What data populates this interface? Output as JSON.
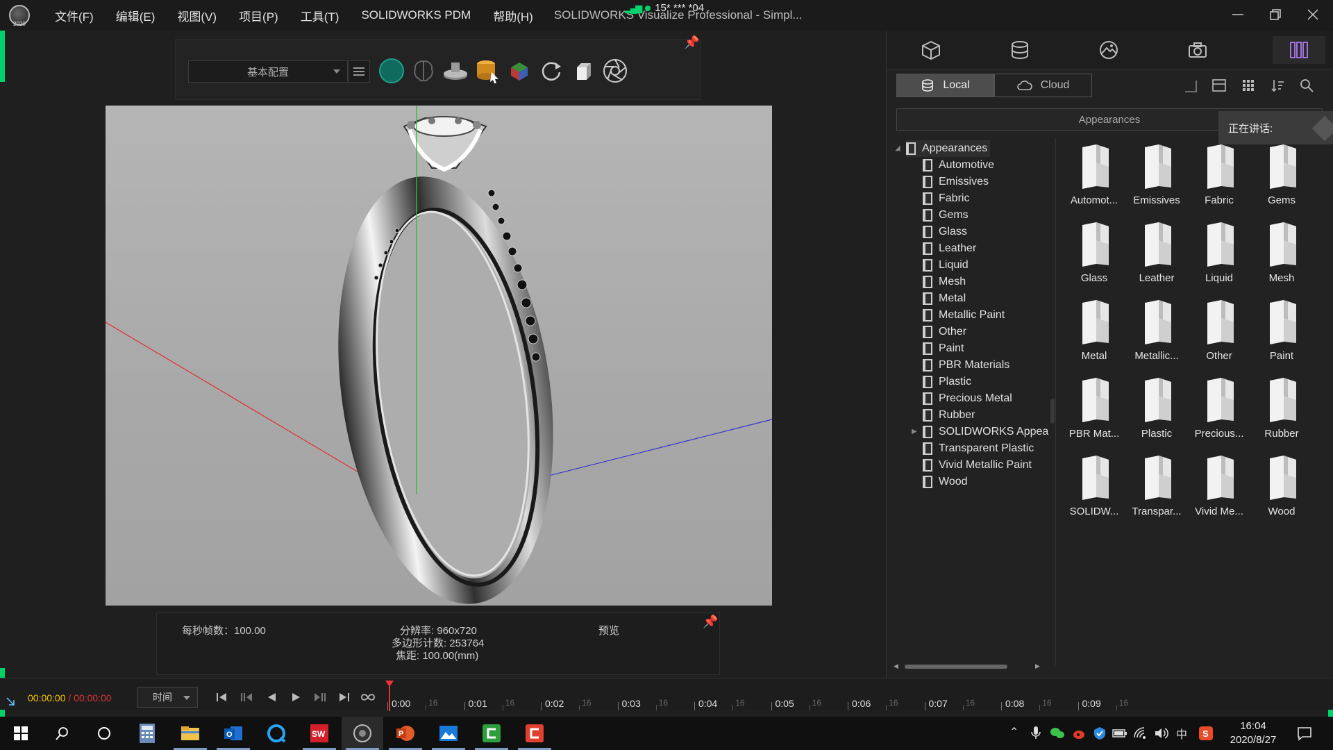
{
  "app": {
    "logo_label": "2020",
    "menu": [
      "文件(F)",
      "编辑(E)",
      "视图(V)",
      "项目(P)",
      "工具(T)",
      "SOLIDWORKS PDM",
      "帮助(H)"
    ],
    "title": "SOLIDWORKS Visualize Professional - Simpl...",
    "network_overlay": "15* *** *04"
  },
  "toolbar": {
    "config_label": "基本配置"
  },
  "stats": {
    "fps": "每秒帧数：100.00",
    "resolution": "分辨率: 960x720",
    "polycount": "多边形计数: 253764",
    "focal": "焦距: 100.00(mm)",
    "mode": "预览"
  },
  "library": {
    "local_label": "Local",
    "cloud_label": "Cloud",
    "category_title": "Appearances",
    "speaking_label": "正在讲话:",
    "tree_root": "Appearances",
    "tree": [
      "Automotive",
      "Emissives",
      "Fabric",
      "Gems",
      "Glass",
      "Leather",
      "Liquid",
      "Mesh",
      "Metal",
      "Metallic Paint",
      "Other",
      "Paint",
      "PBR Materials",
      "Plastic",
      "Precious Metal",
      "Rubber",
      "SOLIDWORKS Appea",
      "Transparent Plastic",
      "Vivid Metallic Paint",
      "Wood"
    ],
    "tiles": [
      "Automot...",
      "Emissives",
      "Fabric",
      "Gems",
      "Glass",
      "Leather",
      "Liquid",
      "Mesh",
      "Metal",
      "Metallic...",
      "Other",
      "Paint",
      "PBR Mat...",
      "Plastic",
      "Precious...",
      "Rubber",
      "SOLIDW...",
      "Transpar...",
      "Vivid Me...",
      "Wood"
    ]
  },
  "timeline": {
    "current_time": "00:00:00",
    "separator": " / ",
    "total_time": "00:00:00",
    "mode_select": "时间",
    "major_labels": [
      "0:00",
      "0:01",
      "0:02",
      "0:03",
      "0:04",
      "0:05",
      "0:06",
      "0:07",
      "0:08",
      "0:09"
    ],
    "minor_label": "16"
  },
  "taskbar": {
    "time": "16:04",
    "date": "2020/8/27",
    "ime": "中"
  },
  "colors": {
    "accent_green": "#00d26a",
    "playhead_red": "#e33333",
    "time_current": "#f2c200",
    "active_tab_purple": "#a070e0"
  }
}
